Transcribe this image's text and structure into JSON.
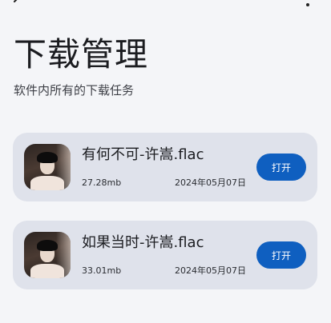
{
  "page": {
    "title": "下载管理",
    "subtitle": "软件内所有的下载任务"
  },
  "topbar": {
    "back_icon": "back-arrow-icon",
    "more_icon": "more-vertical-icon"
  },
  "downloads": [
    {
      "title": "有何不可-许嵩.flac",
      "size": "27.28mb",
      "date": "2024年05月07日",
      "action_label": "打开"
    },
    {
      "title": "如果当时-许嵩.flac",
      "size": "33.01mb",
      "date": "2024年05月07日",
      "action_label": "打开"
    }
  ],
  "colors": {
    "background": "#f4f5f8",
    "card": "#dfe2eb",
    "button": "#0f5fc0"
  }
}
